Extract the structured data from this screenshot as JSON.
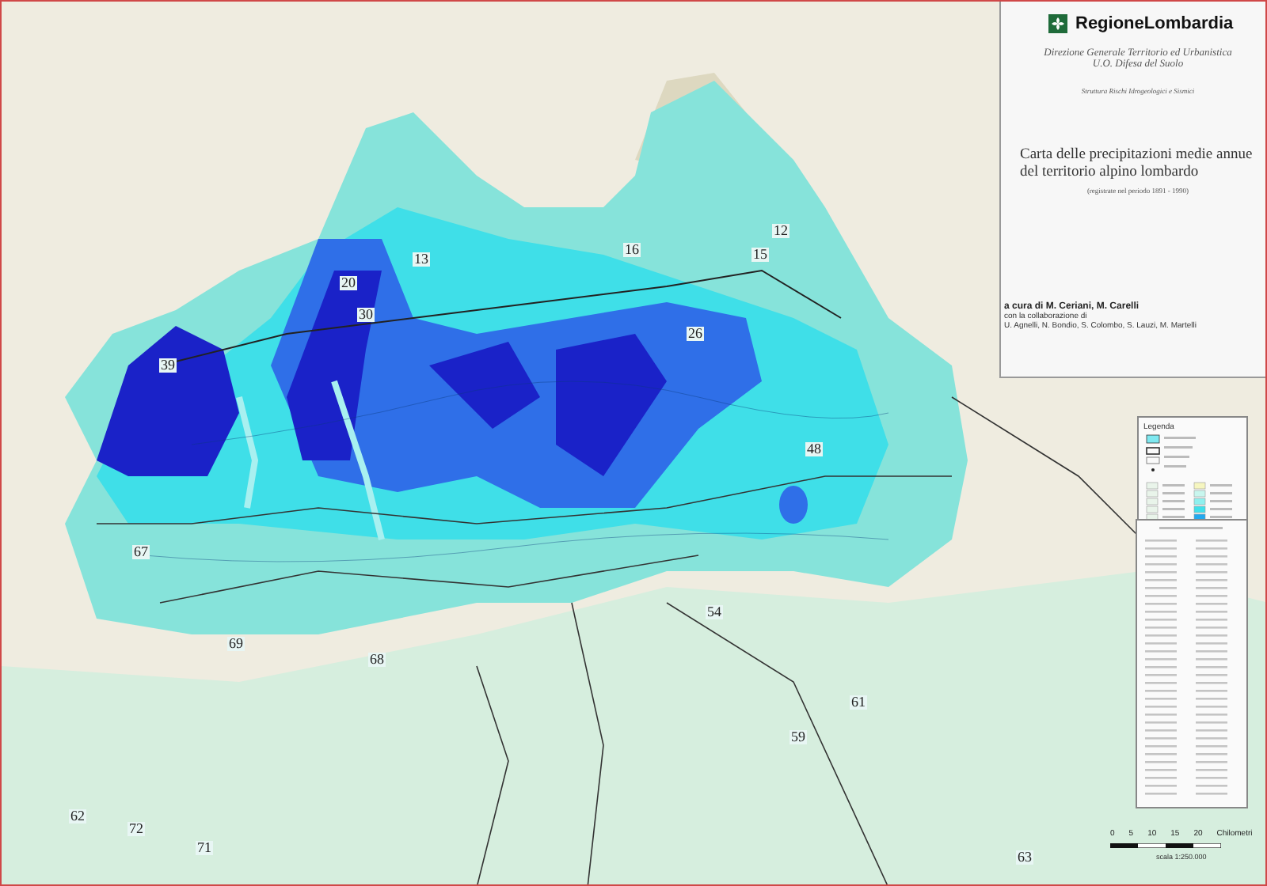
{
  "header": {
    "logo": "RegioneLombardia",
    "department": "Direzione Generale Territorio ed Urbanistica",
    "unit": "U.O. Difesa del Suolo",
    "structure": "Struttura Rischi Idrogeologici e Sismici",
    "title": "Carta delle precipitazioni medie annue del territorio alpino lombardo",
    "subtitle": "(registrate nel periodo 1891 - 1990)",
    "authors": "a cura di M. Ceriani, M. Carelli",
    "collaboration": "con la collaborazione di",
    "collaborators": "U. Agnelli, N. Bondio, S. Colombo, S. Lauzi, M. Martelli"
  },
  "legend": {
    "title": "Legenda"
  },
  "map_labels": [
    "12",
    "13",
    "15",
    "16",
    "20",
    "26",
    "30",
    "39",
    "48",
    "54",
    "59",
    "61",
    "62",
    "63",
    "67",
    "68",
    "69",
    "71",
    "72"
  ],
  "scale": {
    "ticks": [
      "0",
      "5",
      "10",
      "15",
      "20"
    ],
    "unit": "Chilometri",
    "ratio": "scala 1:250.000"
  }
}
